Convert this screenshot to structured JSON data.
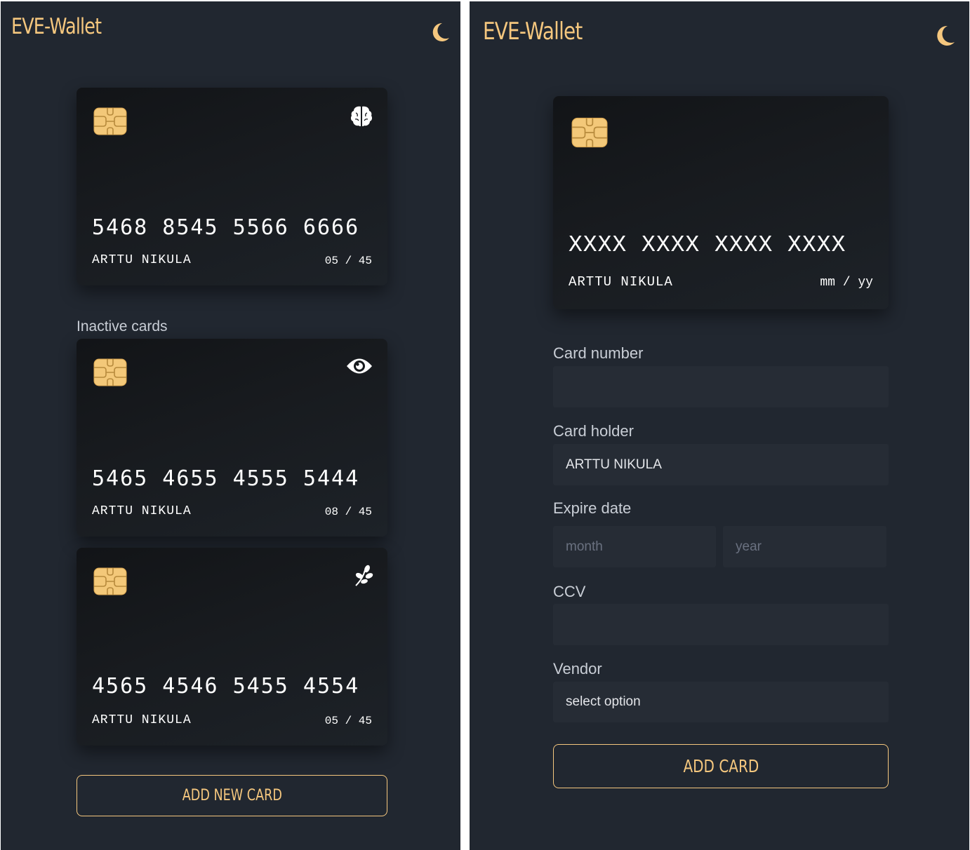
{
  "app": {
    "title": "EVE-Wallet"
  },
  "colors": {
    "accent": "#f5c77e",
    "background": "#212730",
    "card": "#16191d",
    "input": "#262c35"
  },
  "icons": {
    "theme_toggle": "moon-icon",
    "chip": "chip-icon"
  },
  "wallet_view": {
    "active_card": {
      "number": "5468 8545 5566 6666",
      "holder": "ARTTU NIKULA",
      "expiry": "05 / 45",
      "vendor_icon": "brain-icon"
    },
    "inactive_label": "Inactive cards",
    "inactive_cards": [
      {
        "number": "5465 4655 4555 5444",
        "holder": "ARTTU NIKULA",
        "expiry": "08 / 45",
        "vendor_icon": "eye-icon"
      },
      {
        "number": "4565 4546 5455 4554",
        "holder": "ARTTU NIKULA",
        "expiry": "05 / 45",
        "vendor_icon": "leaf-icon"
      }
    ],
    "add_button": "ADD NEW CARD"
  },
  "add_card_view": {
    "preview": {
      "number": "XXXX XXXX XXXX XXXX",
      "holder": "ARTTU NIKULA",
      "expiry": "mm / yy"
    },
    "form": {
      "card_number": {
        "label": "Card number",
        "value": "",
        "placeholder": ""
      },
      "card_holder": {
        "label": "Card holder",
        "value": "ARTTU NIKULA"
      },
      "expire_date": {
        "label": "Expire date",
        "month_placeholder": "month",
        "year_placeholder": "year"
      },
      "ccv": {
        "label": "CCV",
        "value": ""
      },
      "vendor": {
        "label": "Vendor",
        "selected": "select option"
      }
    },
    "submit_button": "ADD CARD"
  }
}
